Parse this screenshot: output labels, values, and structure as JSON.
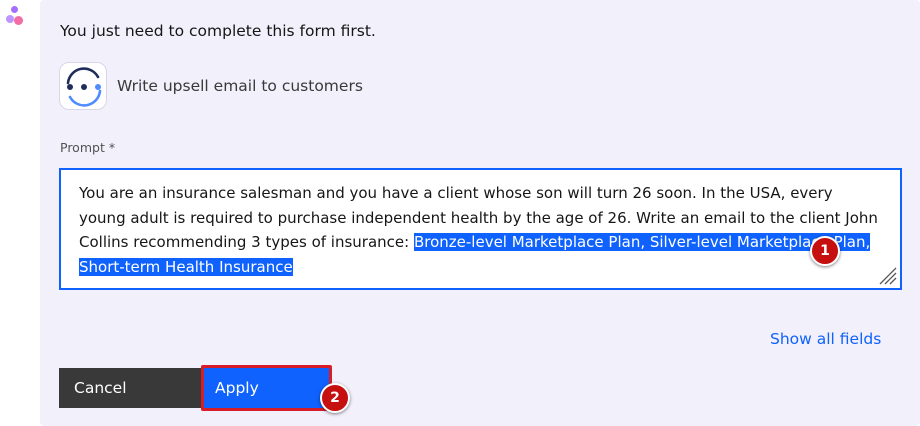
{
  "message": {
    "intro": "You just need to complete this form first."
  },
  "app": {
    "icon": "watsonx-assistant-icon",
    "title": "Write upsell email to customers"
  },
  "form": {
    "prompt_label": "Prompt *",
    "prompt_text": "You are an insurance salesman and you have a client whose son will turn 26 soon. In the USA, every young adult is required to purchase independent health by the age of 26. Write an email to the client John Collins  recommending 3 types of insurance: ",
    "prompt_selected_text": "Bronze-level Marketplace Plan, Silver-level Marketplace Plan, Short-term Health Insurance",
    "show_all_fields": "Show all fields"
  },
  "actions": {
    "cancel_label": "Cancel",
    "apply_label": "Apply"
  },
  "annotations": {
    "badge_1": "1",
    "badge_2": "2"
  },
  "colors": {
    "accent": "#0f62fe",
    "card_background": "#f2f0fb",
    "cancel_button": "#393939",
    "annotation_red": "#c60f0f"
  }
}
